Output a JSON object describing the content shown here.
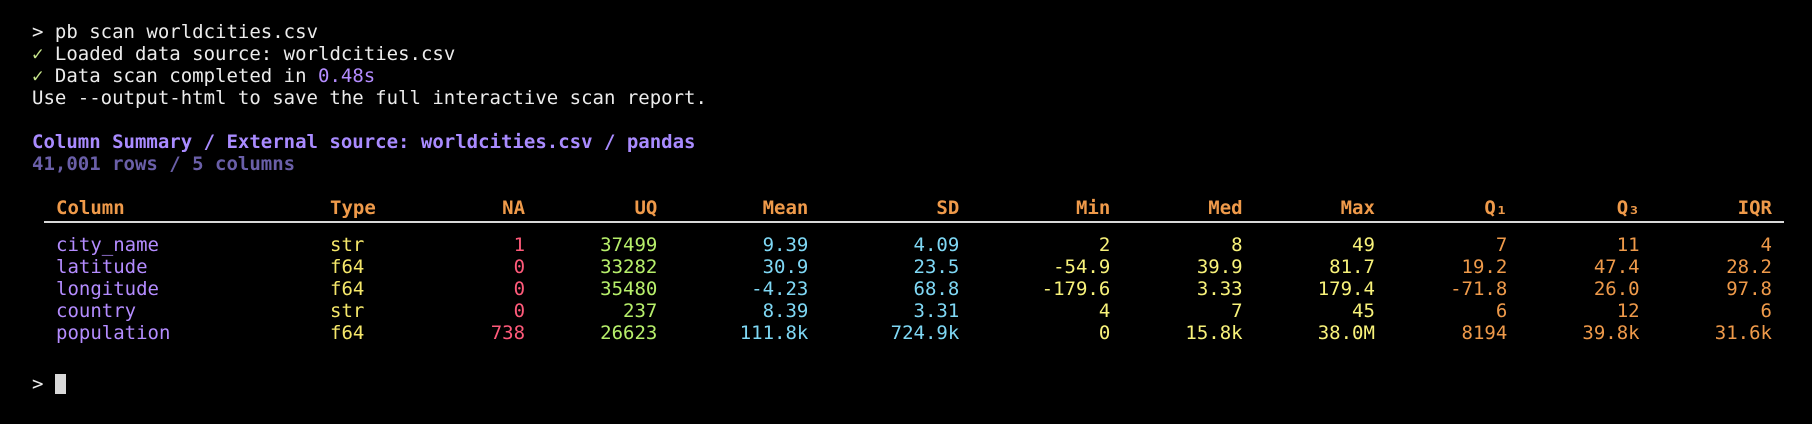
{
  "terminal": {
    "command_prompt": ">",
    "command": "pb scan worldcities.csv",
    "check_mark": "✓",
    "loaded_line": "Loaded data source: worldcities.csv",
    "scan_prefix": "Data scan completed in ",
    "scan_time": "0.48s",
    "hint_line": "Use --output-html to save the full interactive scan report.",
    "report_title": "Column Summary / External source: worldcities.csv / pandas",
    "report_subtitle": "41,001 rows / 5 columns",
    "final_prompt": ">"
  },
  "table": {
    "headers": [
      "Column",
      "Type",
      "NA",
      "UQ",
      "Mean",
      "SD",
      "Min",
      "Med",
      "Max",
      "Q₁",
      "Q₃",
      "IQR"
    ],
    "rows": [
      [
        "city_name",
        "str",
        "1",
        "37499",
        "9.39",
        "4.09",
        "2",
        "8",
        "49",
        "7",
        "11",
        "4"
      ],
      [
        "latitude",
        "f64",
        "0",
        "33282",
        "30.9",
        "23.5",
        "-54.9",
        "39.9",
        "81.7",
        "19.2",
        "47.4",
        "28.2"
      ],
      [
        "longitude",
        "f64",
        "0",
        "35480",
        "-4.23",
        "68.8",
        "-179.6",
        "3.33",
        "179.4",
        "-71.8",
        "26.0",
        "97.8"
      ],
      [
        "country",
        "str",
        "0",
        "237",
        "8.39",
        "3.31",
        "4",
        "7",
        "45",
        "6",
        "12",
        "6"
      ],
      [
        "population",
        "f64",
        "738",
        "26623",
        "111.8k",
        "724.9k",
        "0",
        "15.8k",
        "38.0M",
        "8194",
        "39.8k",
        "31.6k"
      ]
    ]
  },
  "colors": {
    "background": "#000000",
    "column_name": "#b48cff",
    "type": "#f5e76a",
    "na": "#ff5a7a",
    "uq": "#b7ef6b",
    "mean_sd": "#7fd8f5",
    "min_med_max": "#f8f27a",
    "quartiles": "#ef9a4a",
    "header": "#ef9a4a"
  }
}
